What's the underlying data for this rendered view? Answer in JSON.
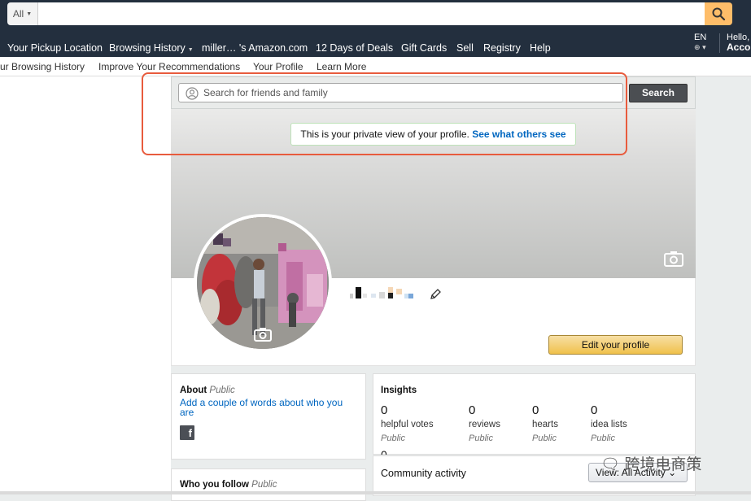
{
  "topbar": {
    "category_label": "All",
    "search_value": "",
    "search_placeholder": ""
  },
  "nav": {
    "items": [
      {
        "label": "Your Pickup Location"
      },
      {
        "label": "Browsing History",
        "has_caret": true
      },
      {
        "label": "miller… 's Amazon.com"
      },
      {
        "label": "12 Days of Deals"
      },
      {
        "label": "Gift Cards"
      },
      {
        "label": "Sell"
      },
      {
        "label": "Registry"
      },
      {
        "label": "Help"
      }
    ],
    "language": "EN",
    "greeting": "Hello,",
    "account": "Acco"
  },
  "subnav": {
    "items": [
      "ur Browsing History",
      "Improve Your Recommendations",
      "Your Profile",
      "Learn More"
    ]
  },
  "friend_search": {
    "placeholder": "Search for friends and family",
    "button": "Search"
  },
  "private_note": {
    "text": "This is your private view of your profile.",
    "link": "See what others see"
  },
  "profile": {
    "edit_button": "Edit your profile"
  },
  "about": {
    "title": "About",
    "visibility": "Public",
    "link": "Add a couple of words about who you are"
  },
  "follow": {
    "title": "Who you follow",
    "visibility": "Public"
  },
  "insights": {
    "title": "Insights",
    "stats": [
      {
        "value": "0",
        "label": "helpful votes",
        "visibility": "Public"
      },
      {
        "value": "0",
        "label": "reviews",
        "visibility": "Public"
      },
      {
        "value": "0",
        "label": "hearts",
        "visibility": "Public"
      },
      {
        "value": "0",
        "label": "idea lists",
        "visibility": "Public"
      }
    ],
    "extra_value": "0"
  },
  "community": {
    "title": "Community activity",
    "view_select": "View: All Activity"
  },
  "watermark": "跨境电商策",
  "colors": {
    "nav_bg": "#232f3e",
    "search_btn": "#febd69",
    "link": "#0066c0",
    "highlight_frame": "#e85b3d",
    "edit_btn": "#f0c14b"
  }
}
